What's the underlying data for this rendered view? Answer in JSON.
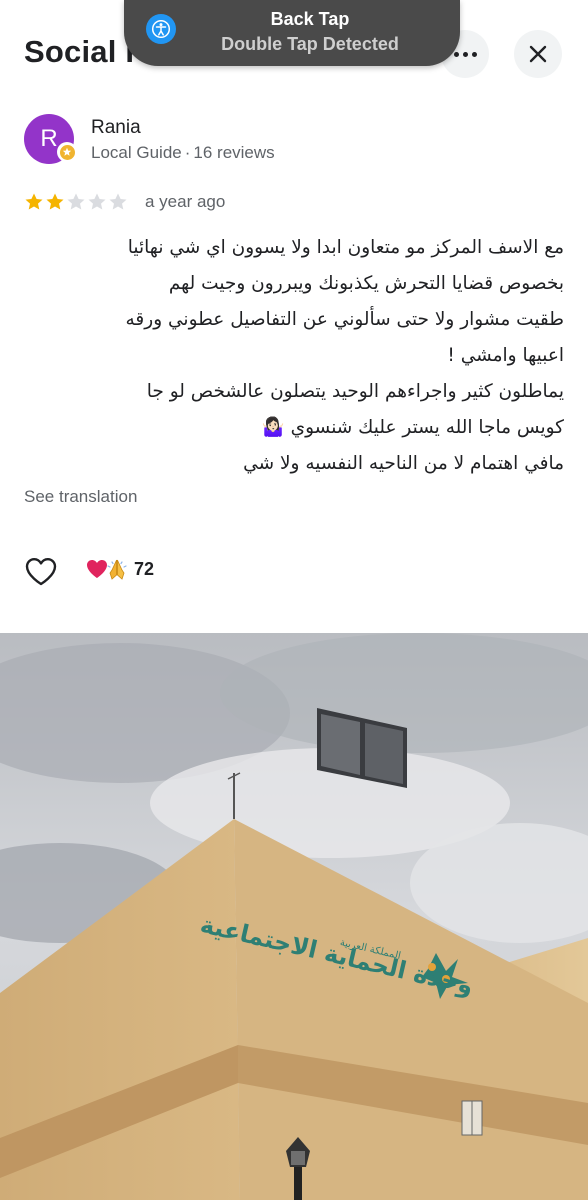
{
  "header": {
    "title": "Social F",
    "more_icon": "more-horiz-icon",
    "close_icon": "close-icon"
  },
  "toast": {
    "icon": "accessibility-icon",
    "line1": "Back Tap",
    "line2": "Double Tap Detected"
  },
  "reviewer": {
    "avatar_letter": "R",
    "avatar_color": "#9334c9",
    "name": "Rania",
    "role": "Local Guide",
    "separator": "·",
    "reviews": "16 reviews"
  },
  "rating": {
    "stars": 2,
    "max": 5,
    "time": "a year ago"
  },
  "review": {
    "lines": [
      "مع الاسف المركز مو متعاون ابدا ولا يسوون اي شي نهائيا",
      "بخصوص قضايا التحرش يكذبونك ويبررون وجيت لهم",
      "طقيت مشوار ولا حتى سألوني عن التفاصيل عطوني ورقه",
      "اعبيها وامشي !",
      "يماطلون كثير واجراءهم الوحيد يتصلون عالشخص لو جا",
      "كويس ماجا الله يستر عليك شنسوي 🤷🏻‍♀️",
      "مافي اهتمام لا من الناحيه النفسيه ولا شي"
    ],
    "see_translation": "See translation"
  },
  "actions": {
    "like_icon": "heart-outline-icon",
    "reactions": [
      "red-heart-emoji",
      "folded-hands-emoji"
    ],
    "count": "72"
  },
  "photo": {
    "sign_text": "وحدة الحماية الاجتماعية",
    "colors": {
      "sky": "#c9ccd0",
      "wall": "#d8b681",
      "stripe": "#c09866",
      "sign": "#2e7f74"
    }
  }
}
